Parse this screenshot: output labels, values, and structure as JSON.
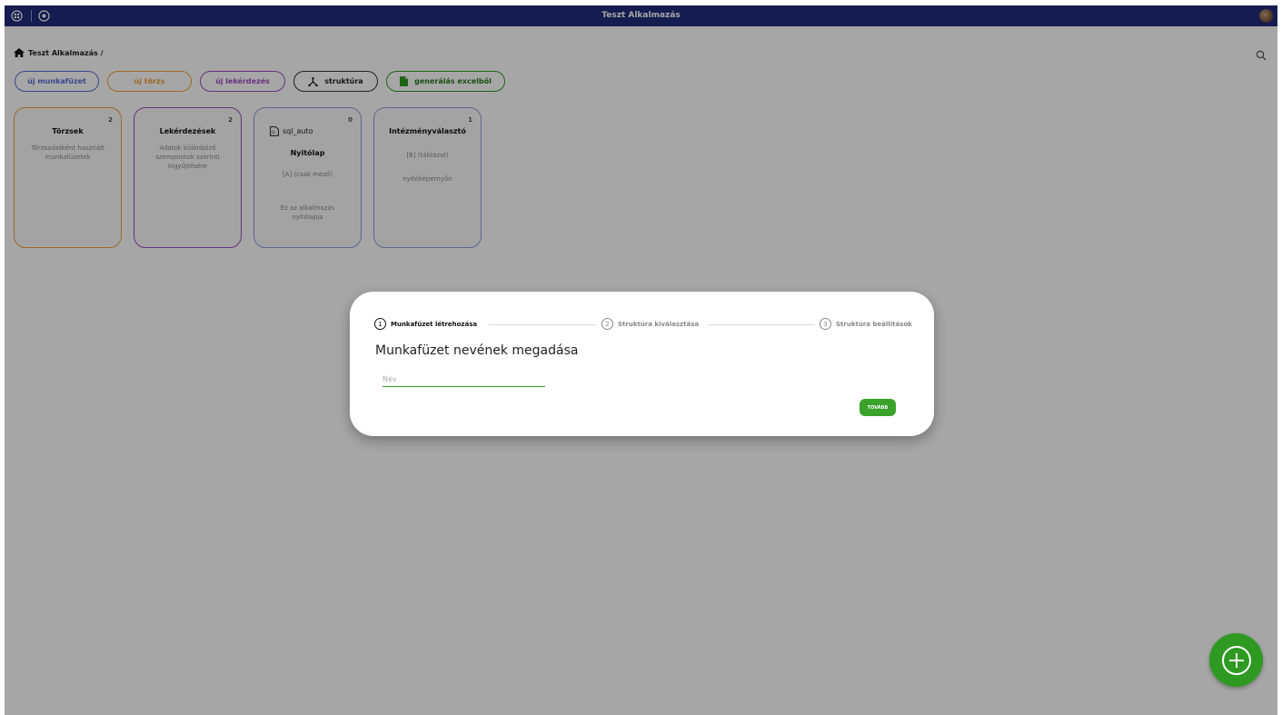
{
  "topbar": {
    "title": "Teszt Alkalmazás",
    "left_icons": [
      "grid-icon",
      "play-circle-icon"
    ]
  },
  "breadcrumb": {
    "text": "Teszt Alkalmazás /"
  },
  "toolbar": {
    "new_workbook": "új munkafüzet",
    "new_master": "új törzs",
    "new_query": "új lekérdezés",
    "structure": "struktúra",
    "generate_excel": "generálás excelből"
  },
  "colors": {
    "topbar": "#1f2c7c",
    "blue": "#5b6fd6",
    "orange": "#f0a23a",
    "purple": "#a14ec2",
    "green": "#2f9a22",
    "card_blue": "#8f9fe0"
  },
  "cards": [
    {
      "count": "2",
      "title": "Törzsek",
      "desc": "Törzsadatként használt munkafüzetek"
    },
    {
      "count": "2",
      "title": "Lekérdezések",
      "desc": "Adatok különböző szempontok szerinti kigyűjtésére"
    },
    {
      "count": "0",
      "tag": "sql_auto",
      "title": "Nyitólap",
      "line1": "[A] (csak mező)",
      "desc": "Ez az alkalmazás nyitólapja"
    },
    {
      "count": "1",
      "title": "Intézményválasztó",
      "line1": "[B] (táblázat)",
      "desc": "nyitóképernyőn"
    }
  ],
  "dialog": {
    "steps": [
      {
        "num": "1",
        "label": "Munkafüzet létrehozása"
      },
      {
        "num": "2",
        "label": "Struktúra kiválasztása"
      },
      {
        "num": "3",
        "label": "Struktúra beállítások"
      }
    ],
    "title": "Munkafüzet nevének megadása",
    "name_placeholder": "Név",
    "name_value": "",
    "next_label": "TOVÁBB"
  }
}
